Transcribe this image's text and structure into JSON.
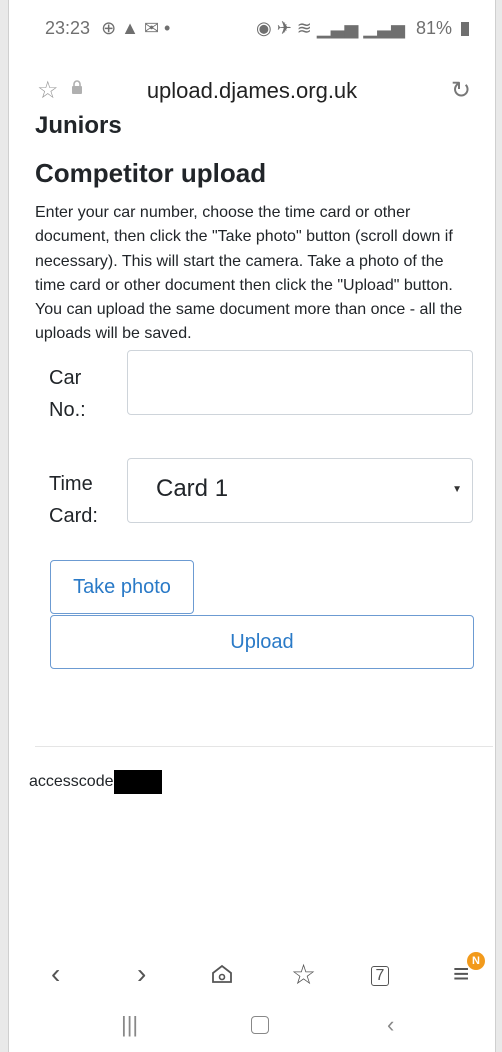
{
  "status_bar": {
    "time": "23:23",
    "left_icons": "⊕ ▲ ✉ •",
    "right_icons": "◉ ✈ ≋ ▁▃▅ ▁▃▅",
    "battery": "81%"
  },
  "browser": {
    "url": "upload.djames.org.uk"
  },
  "page": {
    "section_heading": "Juniors",
    "title": "Competitor upload",
    "instructions": "Enter your car number, choose the time card or other document, then click the \"Take photo\" button (scroll down if necessary). This will start the camera. Take a photo of the time card or other document then click the \"Upload\" button. You can upload the same document more than once - all the uploads will be saved."
  },
  "form": {
    "car_label_line1": "Car",
    "car_label_line2": "No.:",
    "car_value": "",
    "time_label_line1": "Time",
    "time_label_line2": "Card:",
    "time_selected": "Card 1",
    "take_photo_label": "Take photo",
    "upload_label": "Upload"
  },
  "footer": {
    "access_label": "accesscode"
  },
  "bottom_nav": {
    "tabs_count": "7",
    "badge": "N"
  }
}
